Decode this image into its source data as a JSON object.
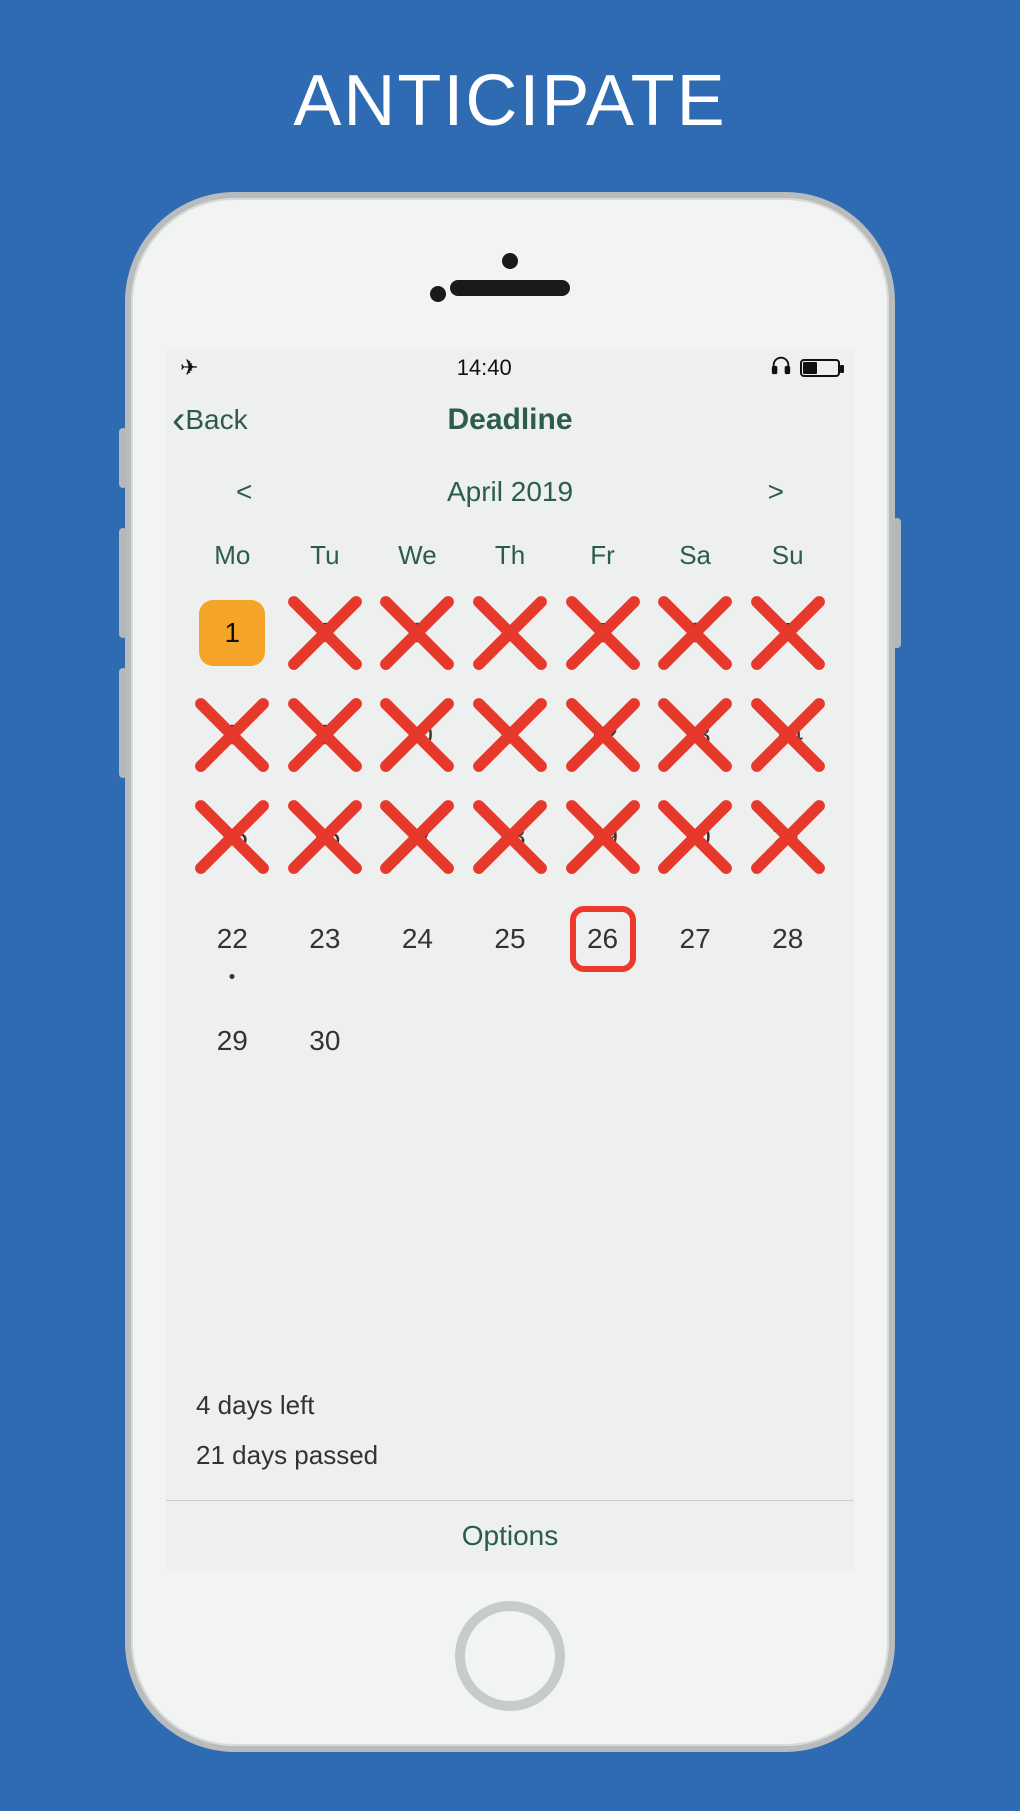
{
  "headline": "ANTICIPATE",
  "status": {
    "time": "14:40"
  },
  "nav": {
    "back_label": "Back",
    "title": "Deadline"
  },
  "month": {
    "prev": "<",
    "label": "April 2019",
    "next": ">"
  },
  "weekdays": [
    "Mo",
    "Tu",
    "We",
    "Th",
    "Fr",
    "Sa",
    "Su"
  ],
  "days": [
    {
      "n": 1,
      "start": true
    },
    {
      "n": 2,
      "crossed": true
    },
    {
      "n": 3,
      "crossed": true
    },
    {
      "n": 4,
      "crossed": true
    },
    {
      "n": 5,
      "crossed": true
    },
    {
      "n": 6,
      "crossed": true
    },
    {
      "n": 7,
      "crossed": true
    },
    {
      "n": 8,
      "crossed": true
    },
    {
      "n": 9,
      "crossed": true
    },
    {
      "n": 10,
      "crossed": true
    },
    {
      "n": 11,
      "crossed": true
    },
    {
      "n": 12,
      "crossed": true
    },
    {
      "n": 13,
      "crossed": true
    },
    {
      "n": 14,
      "crossed": true
    },
    {
      "n": 15,
      "crossed": true
    },
    {
      "n": 16,
      "crossed": true
    },
    {
      "n": 17,
      "crossed": true
    },
    {
      "n": 18,
      "crossed": true
    },
    {
      "n": 19,
      "crossed": true
    },
    {
      "n": 20,
      "crossed": true
    },
    {
      "n": 21,
      "crossed": true
    },
    {
      "n": 22,
      "today": true
    },
    {
      "n": 23
    },
    {
      "n": 24
    },
    {
      "n": 25
    },
    {
      "n": 26,
      "deadline": true
    },
    {
      "n": 27
    },
    {
      "n": 28
    },
    {
      "n": 29
    },
    {
      "n": 30
    }
  ],
  "summary": {
    "days_left": "4 days left",
    "days_passed": "21 days passed"
  },
  "footer": {
    "options": "Options"
  }
}
